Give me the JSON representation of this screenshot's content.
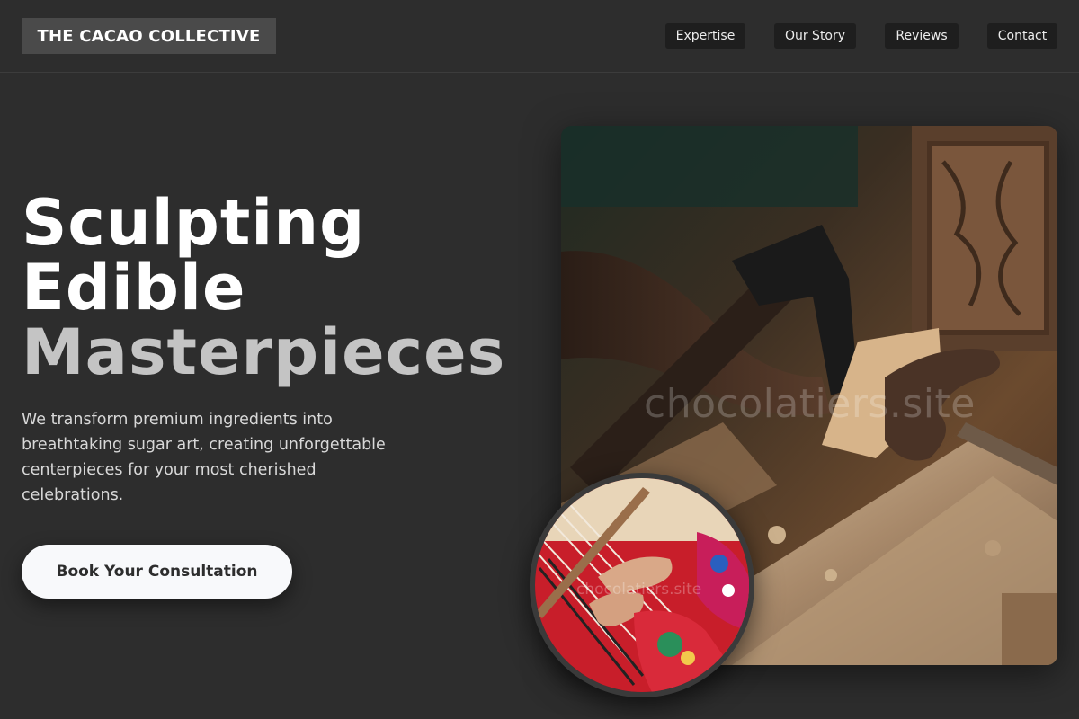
{
  "brand": {
    "name": "THE CACAO COLLECTIVE"
  },
  "nav": {
    "items": [
      {
        "label": "Expertise"
      },
      {
        "label": "Our Story"
      },
      {
        "label": "Reviews"
      },
      {
        "label": "Contact"
      }
    ]
  },
  "hero": {
    "headline_line1": "Sculpting",
    "headline_line2": "Edible",
    "headline_line3": "Masterpieces",
    "subtext": "We transform premium ingredients into breathtaking sugar art, creating unforgettable centerpieces for your most cherished celebrations.",
    "cta_label": "Book Your Consultation",
    "main_image_watermark": "chocolatiers.site",
    "secondary_image_watermark": "chocolatiers.site"
  },
  "colors": {
    "background": "#2d2d2d",
    "brand_box": "#4a4a4a",
    "nav_button": "#1e1e1e",
    "cta_background": "#f8f9fb",
    "headline_accent": "#c4c4c4"
  }
}
